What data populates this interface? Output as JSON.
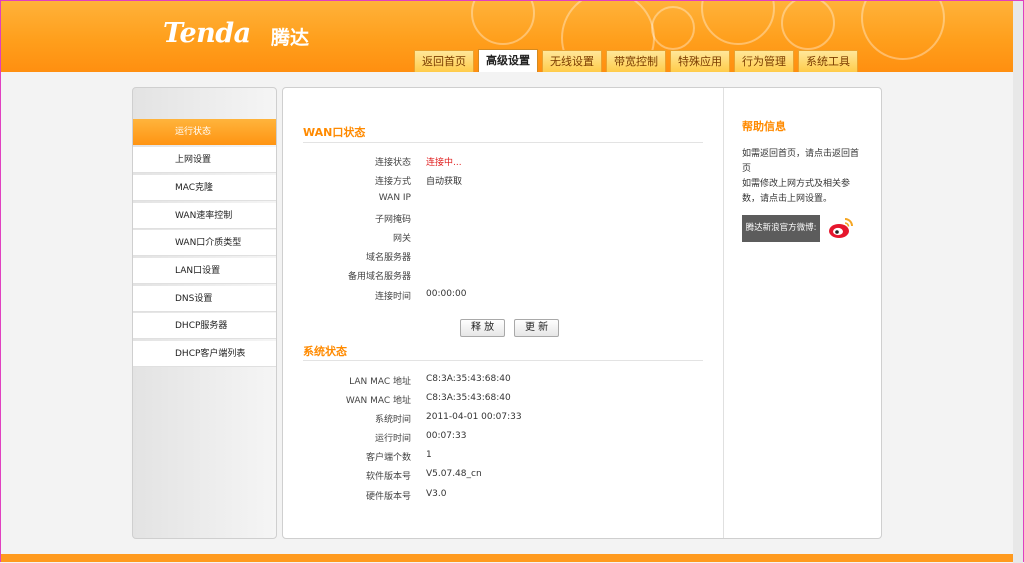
{
  "brand": {
    "logo": "Tenda",
    "logo_cn": "腾达"
  },
  "nav_tabs": [
    "返回首页",
    "高级设置",
    "无线设置",
    "带宽控制",
    "特殊应用",
    "行为管理",
    "系统工具"
  ],
  "nav_active_index": 1,
  "sidebar": {
    "items": [
      "运行状态",
      "上网设置",
      "MAC克隆",
      "WAN速率控制",
      "WAN口介质类型",
      "LAN口设置",
      "DNS设置",
      "DHCP服务器",
      "DHCP客户端列表"
    ],
    "active_index": 0
  },
  "wan_status": {
    "title": "WAN口状态",
    "rows": [
      {
        "label": "连接状态",
        "value": "连接中..."
      },
      {
        "label": "连接方式",
        "value": "自动获取"
      },
      {
        "label": "WAN IP",
        "value": ""
      },
      {
        "label": "子网掩码",
        "value": ""
      },
      {
        "label": "网关",
        "value": ""
      },
      {
        "label": "域名服务器",
        "value": ""
      },
      {
        "label": "备用域名服务器",
        "value": ""
      },
      {
        "label": "连接时间",
        "value": "00:00:00"
      }
    ],
    "release_button": "释 放",
    "renew_button": "更 新"
  },
  "system_status": {
    "title": "系统状态",
    "rows": [
      {
        "label": "LAN MAC 地址",
        "value": "C8:3A:35:43:68:40"
      },
      {
        "label": "WAN MAC 地址",
        "value": "C8:3A:35:43:68:40"
      },
      {
        "label": "系统时间",
        "value": "2011-04-01 00:07:33"
      },
      {
        "label": "运行时间",
        "value": "00:07:33"
      },
      {
        "label": "客户端个数",
        "value": "1"
      },
      {
        "label": "软件版本号",
        "value": "V5.07.48_cn"
      },
      {
        "label": "硬件版本号",
        "value": "V3.0"
      }
    ]
  },
  "help": {
    "title": "帮助信息",
    "text1": "如需返回首页，请点击返回首页",
    "text2": "如需修改上网方式及相关参数，请点击上网设置。",
    "weibo_button": "腾达新浪官方微博:",
    "weibo_icon": "weibo-icon"
  },
  "colors": {
    "accent": "#ff9a1e",
    "status_red": "#e02020",
    "section_title": "#ff8a00"
  }
}
